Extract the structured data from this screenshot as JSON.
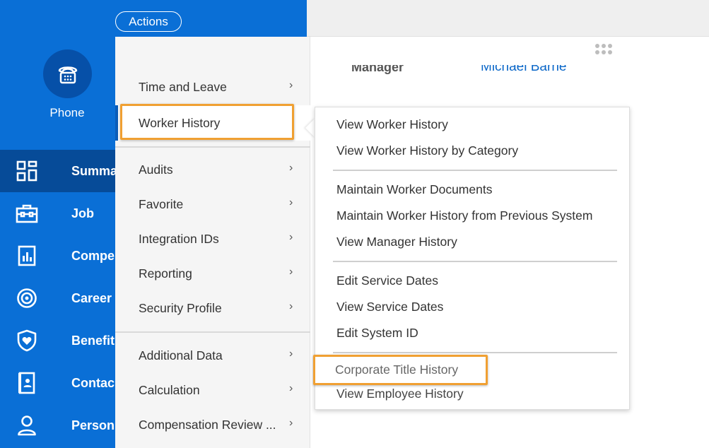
{
  "header": {
    "actions_label": "Actions"
  },
  "phone": {
    "label": "Phone"
  },
  "nav": {
    "items": [
      {
        "label": "Summa",
        "icon": "dashboard-icon"
      },
      {
        "label": "Job",
        "icon": "briefcase-icon"
      },
      {
        "label": "Compe",
        "icon": "chart-icon"
      },
      {
        "label": "Career",
        "icon": "target-icon"
      },
      {
        "label": "Benefit",
        "icon": "shield-heart-icon"
      },
      {
        "label": "Contac",
        "icon": "contact-book-icon"
      },
      {
        "label": "Person",
        "icon": "person-icon"
      }
    ]
  },
  "profile": {
    "manager_label": "Manager",
    "manager_value": "Michael Barne"
  },
  "menu": {
    "items": [
      {
        "label": "Time and Leave",
        "chevron": "›"
      },
      {
        "label": "Worker History"
      },
      {
        "label": "Audits",
        "chevron": "›"
      },
      {
        "label": "Favorite",
        "chevron": "›"
      },
      {
        "label": "Integration IDs",
        "chevron": "›"
      },
      {
        "label": "Reporting",
        "chevron": "›"
      },
      {
        "label": "Security Profile",
        "chevron": "›"
      },
      {
        "label": "Additional Data",
        "chevron": "›"
      },
      {
        "label": "Calculation",
        "chevron": "›"
      },
      {
        "label": "Compensation Review ...",
        "chevron": "›"
      }
    ]
  },
  "submenu": {
    "items": [
      "View Worker History",
      "View Worker History by Category",
      "Maintain Worker Documents",
      "Maintain Worker History from Previous System",
      "View Manager History",
      "Edit Service Dates",
      "View Service Dates",
      "Edit System ID",
      "Corporate Title History",
      "View Employee History"
    ]
  },
  "colors": {
    "primary_blue": "#0a6fd6",
    "active_nav": "#064b98",
    "highlight": "#f0a032",
    "link": "#0b67c8"
  }
}
